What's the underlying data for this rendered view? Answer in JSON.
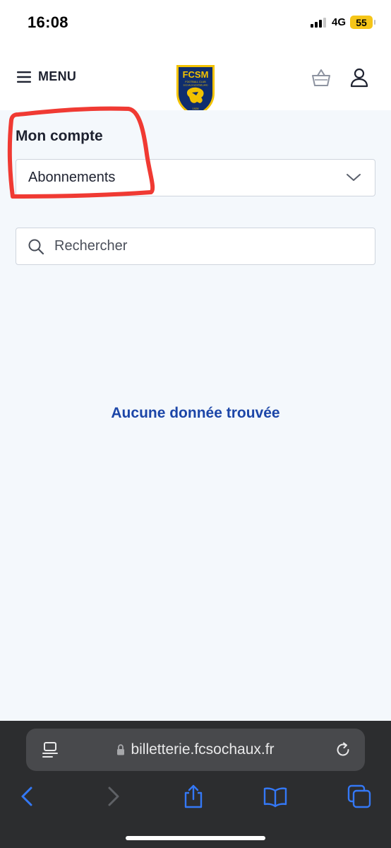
{
  "status_bar": {
    "time": "16:08",
    "network": "4G",
    "battery": "55",
    "battery_color": "#f5c518"
  },
  "header": {
    "menu_label": "MENU",
    "logo": {
      "initials": "FCSM",
      "subtitle": "FOOTBALL CLUB",
      "subtitle2": "SOCHAUX-MONTBÉLIARD",
      "year": "1928"
    },
    "icons": [
      "hamburger-icon",
      "basket-icon",
      "user-icon"
    ]
  },
  "main": {
    "section_title": "Mon compte",
    "account_select": {
      "value": "Abonnements"
    },
    "search": {
      "placeholder": "Rechercher"
    },
    "empty_message": "Aucune donnée trouvée",
    "empty_message_color": "#1c46a8",
    "annotation_color": "#f03a33"
  },
  "browser": {
    "url": "billetterie.fcsochaux.fr",
    "toolbar": [
      "back-icon",
      "forward-icon",
      "share-icon",
      "bookmarks-icon",
      "tabs-icon"
    ],
    "accent": "#3478f6"
  }
}
